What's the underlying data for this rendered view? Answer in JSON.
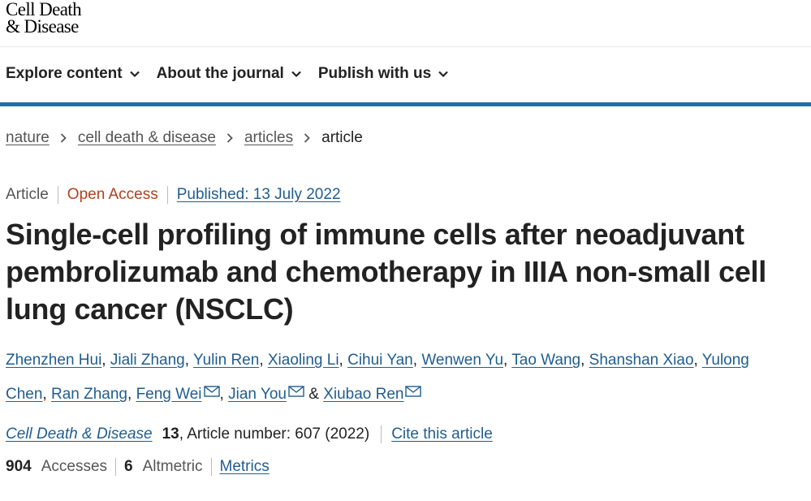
{
  "logo": {
    "line1": "Cell Death",
    "line2": "& Disease"
  },
  "nav": [
    {
      "label": "Explore content",
      "icon": "chevron-down-icon"
    },
    {
      "label": "About the journal",
      "icon": "chevron-down-icon"
    },
    {
      "label": "Publish with us",
      "icon": "chevron-down-icon"
    }
  ],
  "breadcrumb": {
    "items": [
      "nature",
      "cell death & disease",
      "articles"
    ],
    "current": "article"
  },
  "meta": {
    "type": "Article",
    "access": "Open Access",
    "published": "Published: 13 July 2022"
  },
  "title": "Single-cell profiling of immune cells after neoadjuvant pembrolizumab and chemotherapy in IIIA non-small cell lung cancer (NSCLC)",
  "authors": [
    "Zhenzhen Hui",
    "Jiali Zhang",
    "Yulin Ren",
    "Xiaoling Li",
    "Cihui Yan",
    "Wenwen Yu",
    "Tao Wang",
    "Shanshan Xiao",
    "Yulong Chen",
    "Ran Zhang",
    "Feng Wei",
    "Jian You",
    "Xiubao Ren"
  ],
  "author_separator": ", ",
  "author_last_joiner": "&",
  "citation": {
    "journal": "Cell Death & Disease",
    "volume": "13",
    "info": ", Article number: 607 (2022)",
    "cite_link": "Cite this article"
  },
  "metrics": {
    "accesses_count": "904",
    "accesses_label": "Accesses",
    "altmetric_count": "6",
    "altmetric_label": "Altmetric",
    "metrics_link": "Metrics"
  },
  "colors": {
    "accent": "#1f6fa5",
    "link": "#1f5d91",
    "open_access": "#b3401e"
  }
}
